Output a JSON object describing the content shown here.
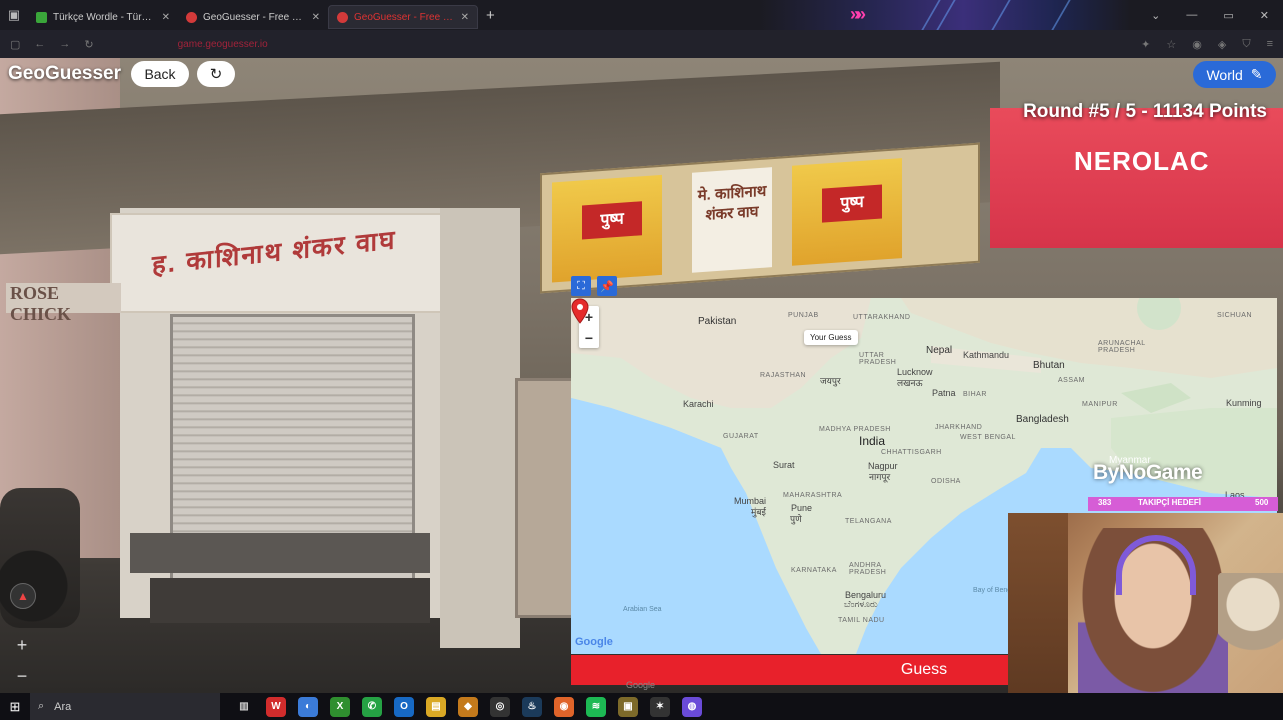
{
  "browser": {
    "tabs": [
      {
        "title": "Türkçe Wordle - Türkçe Kelimel",
        "favicon_color": "#3aa63a",
        "active": false
      },
      {
        "title": "GeoGuesser - Free GeoGuessr A",
        "favicon_color": "#d33a3a",
        "active": false
      },
      {
        "title": "GeoGuesser - Free GeoGue",
        "favicon_color": "#d33a3a",
        "active": true
      }
    ],
    "new_tab": "+",
    "url": "game.geoguesser.io"
  },
  "header": {
    "app_title": "GeoGuesser",
    "back_label": "Back",
    "refresh_icon": "↻",
    "world_label": "World",
    "round_info": "Round #5 / 5 - 11134 Points"
  },
  "street_view": {
    "sign_left": "ROSE CHICK",
    "sign_shop": "ह. काशिनाथ शंकर वाघ",
    "sign_center": "मे. काशिनाथ शंकर वाघ",
    "poster_brand": "पुष्प",
    "sign_right": "NEROLAC"
  },
  "map": {
    "zoom_in": "+",
    "zoom_out": "−",
    "tooltip": "Your Guess",
    "google": "Google",
    "labels": {
      "pakistan": "Pakistan",
      "punjab": "PUNJAB",
      "uttarakhand": "UTTARAKHAND",
      "sichuan": "SICHUAN",
      "nepal": "Nepal",
      "kathmandu": "Kathmandu",
      "bhutan": "Bhutan",
      "arunachal": "ARUNACHAL PRADESH",
      "rajasthan": "RAJASTHAN",
      "uttar_pradesh": "UTTAR PRADESH",
      "lucknow": "Lucknow",
      "lucknow_local": "लखनऊ",
      "assam": "ASSAM",
      "patna": "Patna",
      "bihar": "BIHAR",
      "bangladesh": "Bangladesh",
      "manipur": "MANIPUR",
      "kunming": "Kunming",
      "karachi": "Karachi",
      "gujarat": "GUJARAT",
      "madhya_pradesh": "MADHYA PRADESH",
      "india": "India",
      "jharkhand": "JHARKHAND",
      "west_bengal": "WEST BENGAL",
      "myanmar": "Myanmar",
      "chhattisgarh": "CHHATTISGARH",
      "surat": "Surat",
      "nagpur": "Nagpur",
      "nagpur_local": "नागपूर",
      "odisha": "ODISHA",
      "mumbai": "Mumbai",
      "mumbai_local": "मुंबई",
      "maharashtra": "MAHARASHTRA",
      "pune": "Pune",
      "pune_local": "पुणे",
      "telangana": "TELANGANA",
      "karnataka": "KARNATAKA",
      "andhra": "ANDHRA PRADESH",
      "bengaluru": "Bengaluru",
      "bengaluru_local": "ಬೆಂಗಳೂರು",
      "tamil_nadu": "TAMIL NADU",
      "arabian_sea": "Arabian Sea",
      "bay_of_bengal": "Bay of Beng",
      "laos": "Laos",
      "jaipur_local": "जयपुर"
    }
  },
  "guess_button": "Guess",
  "footer_google": "Google",
  "stream": {
    "brand": "ByNoGame",
    "bar_left": "383",
    "bar_mid": "TAKIPÇİ HEDEFİ",
    "bar_right": "500"
  },
  "taskbar": {
    "search_placeholder": "Ara"
  },
  "colors": {
    "accent_blue": "#2a6ad8",
    "guess_red": "#e8212b",
    "stream_pink": "#d65dd6"
  }
}
